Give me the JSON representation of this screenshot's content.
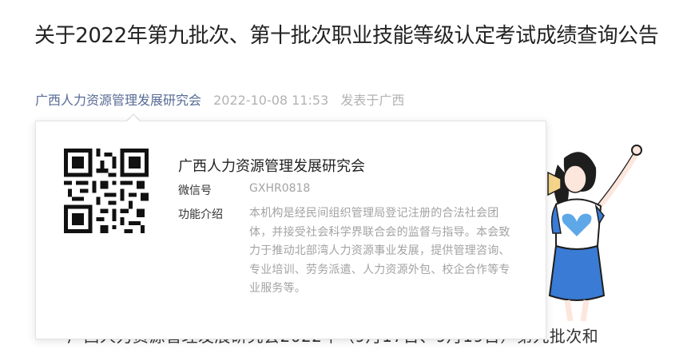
{
  "article": {
    "title": "关于2022年第九批次、第十批次职业技能等级认定考试成绩查询公告",
    "account_name": "广西人力资源管理发展研究会",
    "date": "2022-10-08 11:53",
    "location": "发表于广西",
    "body_partial": "广西人力资源管理发展研究会2022年（9月17日、9月19日）第九批次和"
  },
  "profile_card": {
    "name": "广西人力资源管理发展研究会",
    "wechat_id_label": "微信号",
    "wechat_id": "GXHR0818",
    "intro_label": "功能介绍",
    "intro": "本机构是经民间组织管理局登记注册的合法社会团体，并接受社会科学界联合会的监督与指导。本会致力于推动北部湾人力资源事业发展，提供管理咨询、专业培训、劳务派遣、人力资源外包、校企合作等专业服务等。"
  },
  "colors": {
    "link": "#576b95",
    "muted": "#b2b2b2",
    "illustration_blue": "#3a7bd5",
    "heart": "#5fa8e8"
  },
  "icons": {
    "qr": "qr-code-icon",
    "illustration": "cheering-girl-illustration"
  }
}
